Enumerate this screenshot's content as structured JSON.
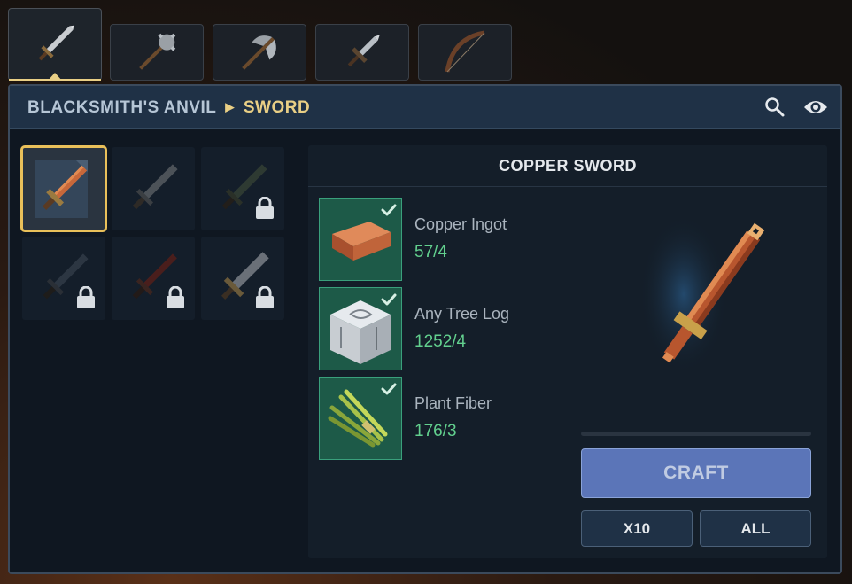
{
  "tabs": [
    {
      "icon": "sword-icon"
    },
    {
      "icon": "mace-icon"
    },
    {
      "icon": "axe-icon"
    },
    {
      "icon": "dagger-icon"
    },
    {
      "icon": "bow-icon"
    }
  ],
  "header": {
    "station": "BLACKSMITH'S ANVIL",
    "category": "SWORD",
    "search_icon": "search-icon",
    "visibility_icon": "eye-icon"
  },
  "recipes": [
    {
      "name": "copper-sword",
      "locked": false,
      "selected": true,
      "icon": "recipe-scroll-icon"
    },
    {
      "name": "iron-sword",
      "locked": false,
      "selected": false
    },
    {
      "name": "dark-sword",
      "locked": true,
      "selected": false
    },
    {
      "name": "steel-sword",
      "locked": true,
      "selected": false
    },
    {
      "name": "crimson-sword",
      "locked": true,
      "selected": false
    },
    {
      "name": "silver-sword",
      "locked": true,
      "selected": false
    }
  ],
  "detail": {
    "title": "COPPER SWORD",
    "ingredients": [
      {
        "name": "Copper Ingot",
        "qty": "57/4",
        "icon": "copper-ingot-icon"
      },
      {
        "name": "Any Tree Log",
        "qty": "1252/4",
        "icon": "tree-log-icon"
      },
      {
        "name": "Plant Fiber",
        "qty": "176/3",
        "icon": "plant-fiber-icon"
      }
    ],
    "craft_label": "CRAFT",
    "x10_label": "X10",
    "all_label": "ALL",
    "progress": 0
  },
  "colors": {
    "accent_gold": "#e9cf85",
    "ready_green": "#62d08e",
    "craft_blue": "#5b75b8"
  }
}
